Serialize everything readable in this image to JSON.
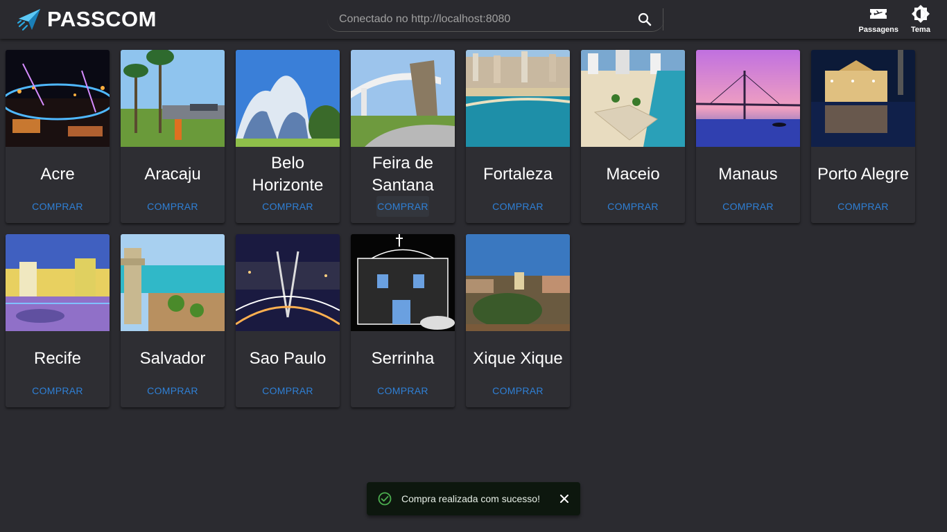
{
  "header": {
    "brand": "PASSCOM",
    "search_placeholder": "Conectado no http://localhost:8080",
    "actions": [
      {
        "label": "Passagens",
        "icon": "ticket-icon"
      },
      {
        "label": "Tema",
        "icon": "brightness-icon"
      }
    ]
  },
  "cities": [
    {
      "name": "Acre",
      "button": "COMPRAR",
      "image": "night-bridge-image"
    },
    {
      "name": "Aracaju",
      "button": "COMPRAR",
      "image": "palm-beach-avenue-image"
    },
    {
      "name": "Belo Horizonte",
      "button": "COMPRAR",
      "image": "modernist-church-image"
    },
    {
      "name": "Feira de Santana",
      "button": "COMPRAR",
      "image": "city-monument-image"
    },
    {
      "name": "Fortaleza",
      "button": "COMPRAR",
      "image": "coastal-skyline-image"
    },
    {
      "name": "Maceio",
      "button": "COMPRAR",
      "image": "beach-aerial-image"
    },
    {
      "name": "Manaus",
      "button": "COMPRAR",
      "image": "sunset-bridge-image"
    },
    {
      "name": "Porto Alegre",
      "button": "COMPRAR",
      "image": "waterfront-building-image"
    },
    {
      "name": "Recife",
      "button": "COMPRAR",
      "image": "colorful-square-image"
    },
    {
      "name": "Salvador",
      "button": "COMPRAR",
      "image": "elevator-bay-image"
    },
    {
      "name": "Sao Paulo",
      "button": "COMPRAR",
      "image": "cable-bridge-night-image"
    },
    {
      "name": "Serrinha",
      "button": "COMPRAR",
      "image": "church-night-image"
    },
    {
      "name": "Xique Xique",
      "button": "COMPRAR",
      "image": "town-hilltop-image"
    }
  ],
  "snackbar": {
    "message": "Compra realizada com sucesso!",
    "status_color": "#4caf50"
  },
  "colors": {
    "accent": "#2f80d6",
    "background": "#2b2b30",
    "card": "#2e2e33"
  }
}
